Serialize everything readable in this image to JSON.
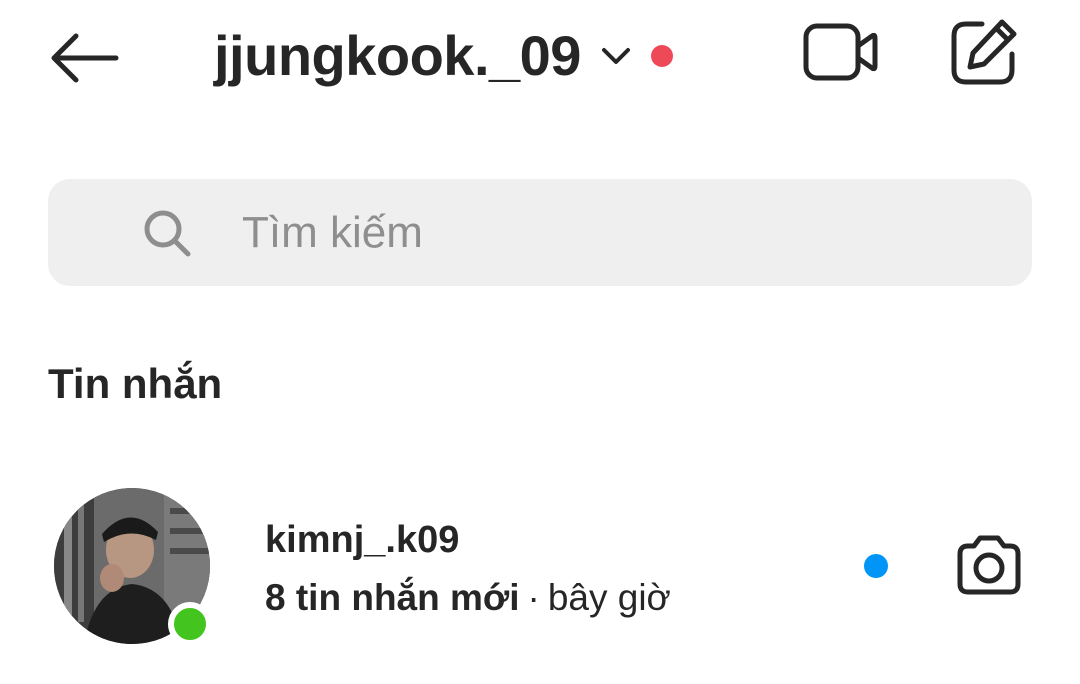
{
  "header": {
    "username": "jjungkook._09",
    "status_dot_color": "#ed4956",
    "icons": {
      "back": "back-arrow-icon",
      "dropdown": "chevron-down-icon",
      "video": "video-camera-icon",
      "compose": "compose-icon"
    }
  },
  "search": {
    "placeholder": "Tìm kiếm",
    "value": "",
    "icon": "search-icon"
  },
  "messages": {
    "section_title": "Tin nhắn",
    "items": [
      {
        "name": "kimnj_.k09",
        "preview": "8 tin nhắn mới",
        "separator": "·",
        "time": "bây giờ",
        "online_color": "#44c41e",
        "unread_color": "#0095f6",
        "action_icon": "camera-icon"
      }
    ]
  }
}
